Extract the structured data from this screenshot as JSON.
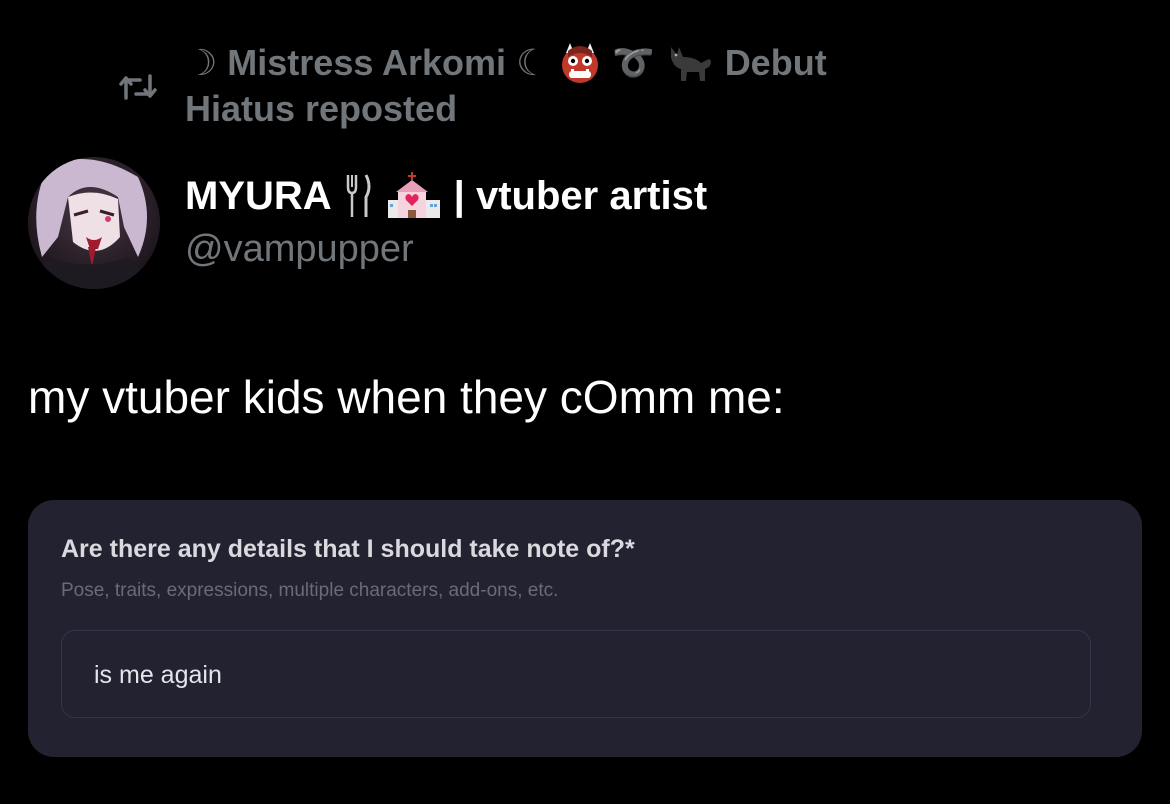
{
  "repost": {
    "icon": "repost-icon",
    "moon_left": "☽",
    "name": "Mistress Arkomi",
    "moon_right": "☾",
    "emoji_1": "ogre-emoji",
    "emoji_2": "➰",
    "emoji_3": "black-cat-emoji",
    "name_suffix": "Debut",
    "line2": "Hiatus reposted"
  },
  "author": {
    "avatar": "avatar",
    "display_name": "MYURA",
    "name_emoji_1": "fork-and-knife-emoji",
    "name_emoji_2": "love-hotel-emoji",
    "name_suffix": "| vtuber artist",
    "handle": "@vampupper"
  },
  "tweet": {
    "text": "my vtuber kids when they cOmm me:"
  },
  "form": {
    "question": "Are there any details that I should take note of?*",
    "hint": "Pose, traits, expressions, multiple characters, add-ons, etc.",
    "input_value": "is me again"
  },
  "colors": {
    "background": "#000000",
    "muted_text": "#71767b",
    "primary_text": "#ffffff",
    "card_background": "#232231",
    "card_border": "#36354a"
  }
}
